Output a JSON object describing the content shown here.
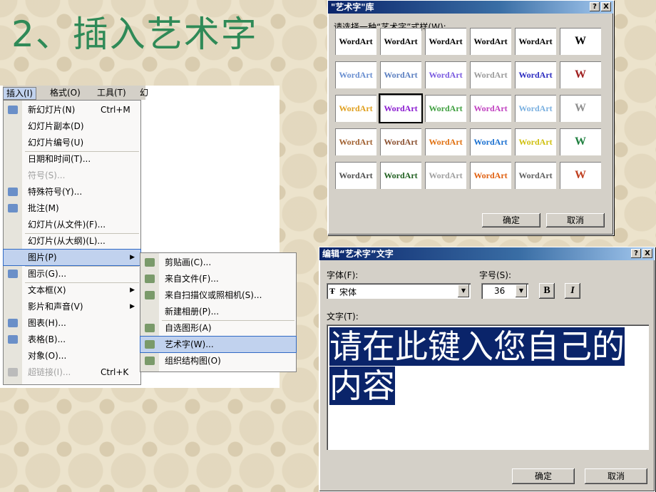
{
  "slide": {
    "title": "2、插入艺术字"
  },
  "menubar": {
    "items": [
      "插入(I)",
      "格式(O)",
      "工具(T)",
      "幻"
    ]
  },
  "insert_menu": {
    "items": [
      {
        "label": "新幻灯片(N)",
        "shortcut": "Ctrl+M",
        "icon": "new-slide-icon"
      },
      {
        "label": "幻灯片副本(D)",
        "shortcut": ""
      },
      {
        "label": "幻灯片编号(U)",
        "shortcut": ""
      },
      {
        "label": "日期和时间(T)...",
        "shortcut": ""
      },
      {
        "label": "符号(S)...",
        "shortcut": "",
        "disabled": true
      },
      {
        "label": "特殊符号(Y)...",
        "shortcut": "",
        "icon": "special-symbol-icon"
      },
      {
        "label": "批注(M)",
        "shortcut": "",
        "icon": "comment-icon"
      },
      {
        "label": "幻灯片(从文件)(F)...",
        "shortcut": ""
      },
      {
        "label": "幻灯片(从大纲)(L)...",
        "shortcut": ""
      },
      {
        "label": "图片(P)",
        "shortcut": "",
        "submenu": true,
        "highlighted": true
      },
      {
        "label": "图示(G)...",
        "shortcut": "",
        "icon": "diagram-icon"
      },
      {
        "label": "文本框(X)",
        "shortcut": "",
        "submenu": true
      },
      {
        "label": "影片和声音(V)",
        "shortcut": "",
        "submenu": true
      },
      {
        "label": "图表(H)...",
        "shortcut": "",
        "icon": "chart-icon"
      },
      {
        "label": "表格(B)...",
        "shortcut": "",
        "icon": "table-icon"
      },
      {
        "label": "对象(O)...",
        "shortcut": ""
      },
      {
        "label": "超链接(I)...",
        "shortcut": "Ctrl+K",
        "disabled": true,
        "icon": "hyperlink-icon"
      }
    ]
  },
  "picture_submenu": {
    "items": [
      {
        "label": "剪贴画(C)...",
        "icon": "clipart-icon"
      },
      {
        "label": "来自文件(F)...",
        "icon": "from-file-icon"
      },
      {
        "label": "来自扫描仪或照相机(S)...",
        "icon": "scanner-icon"
      },
      {
        "label": "新建相册(P)..."
      },
      {
        "label": "自选图形(A)",
        "icon": "autoshape-icon"
      },
      {
        "label": "艺术字(W)...",
        "icon": "wordart-icon",
        "highlighted": true
      },
      {
        "label": "组织结构图(O)",
        "icon": "org-chart-icon"
      }
    ]
  },
  "wordart_gallery": {
    "title": "\"艺术字\"库",
    "prompt": "请选择一种“艺术字”式样(W):",
    "sample": "WordArt",
    "vertical_sample": "W",
    "ok": "确定",
    "cancel": "取消",
    "help": "?",
    "close": "X",
    "styles": [
      [
        "#fff",
        "#000"
      ],
      [
        "#fff",
        "#000"
      ],
      [
        "#fff",
        "#000"
      ],
      [
        "#fff",
        "#000"
      ],
      [
        "#fff",
        "#000"
      ],
      [
        "#fff",
        "#6a8fd0"
      ],
      [
        "#fff",
        "#5b7fc0"
      ],
      [
        "#fff",
        "#7a5be0"
      ],
      [
        "#fff",
        "#9a9a9a"
      ],
      [
        "#fff",
        "#2c2cc0"
      ],
      [
        "#fff",
        "#e0a020"
      ],
      [
        "#fff",
        "#8a1ad0"
      ],
      [
        "#fff",
        "#40a040"
      ],
      [
        "#fff",
        "#c040c0"
      ],
      [
        "#fff",
        "#7ab0e0"
      ],
      [
        "#fff",
        "#a06030"
      ],
      [
        "#fff",
        "#8a5030"
      ],
      [
        "#fff",
        "#e07010"
      ],
      [
        "#fff",
        "#1a70d0"
      ],
      [
        "#fff",
        "#d0c010"
      ],
      [
        "#fff",
        "#505050"
      ],
      [
        "#fff",
        "#206020"
      ],
      [
        "#fff",
        "#a0a0a0"
      ],
      [
        "#fff",
        "#e06010"
      ],
      [
        "#fff",
        "#606060"
      ]
    ],
    "vertical_colors": [
      "#000",
      "#a02020",
      "#909090",
      "#208040",
      "#c04020"
    ]
  },
  "edit_wordart": {
    "title": "编辑“艺术字”文字",
    "font_label": "字体(F):",
    "font_value": "宋体",
    "size_label": "字号(S):",
    "size_value": "36",
    "bold": "B",
    "italic": "I",
    "text_label": "文字(T):",
    "text_value": "请在此键入您自己的内容",
    "ok": "确定",
    "cancel": "取消",
    "help": "?",
    "close": "X"
  }
}
